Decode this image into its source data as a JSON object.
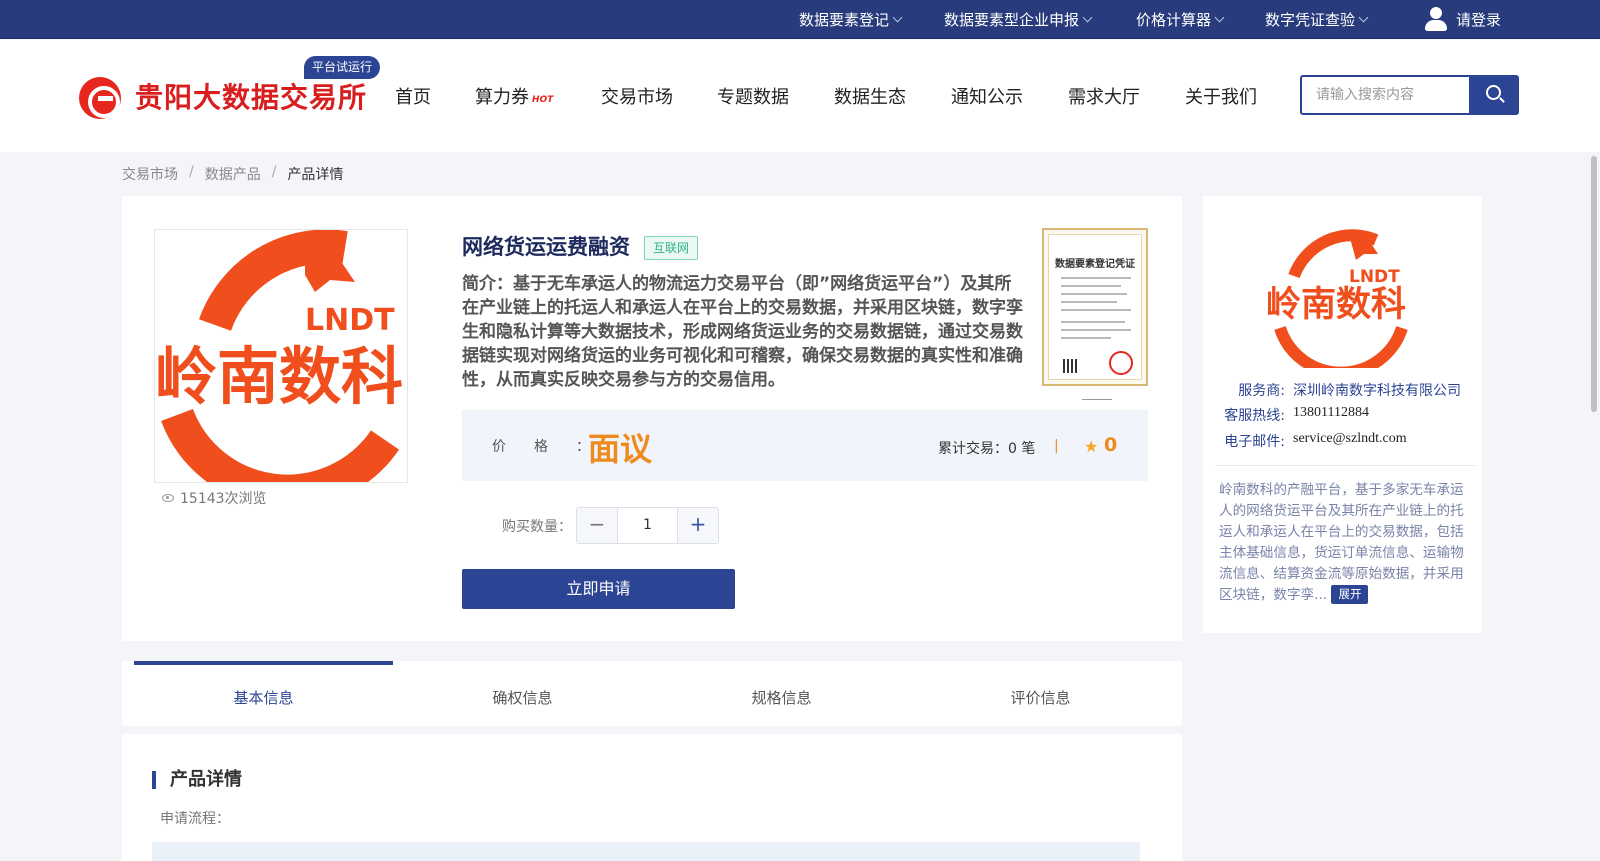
{
  "topbar": {
    "items": [
      {
        "label": "数据要素登记"
      },
      {
        "label": "数据要素型企业申报"
      },
      {
        "label": "价格计算器"
      },
      {
        "label": "数字凭证查验"
      }
    ],
    "login_label": "请登录"
  },
  "header": {
    "site_name": "贵阳大数据交易所",
    "trial_badge": "平台试运行",
    "nav": [
      {
        "label": "首页"
      },
      {
        "label": "算力券",
        "badge": "HOT"
      },
      {
        "label": "交易市场"
      },
      {
        "label": "专题数据"
      },
      {
        "label": "数据生态"
      },
      {
        "label": "通知公示"
      },
      {
        "label": "需求大厅"
      },
      {
        "label": "关于我们"
      }
    ],
    "search_placeholder": "请输入搜索内容"
  },
  "breadcrumb": {
    "items": [
      "交易市场",
      "数据产品",
      "产品详情"
    ],
    "separator": "/"
  },
  "product": {
    "image_logo_text": "LNDT",
    "image_logo_name": "岭南数科",
    "views": "15143次浏览",
    "title": "网络货运运费融资",
    "tag": "互联网",
    "intro": "简介：基于无车承运人的物流运力交易平台（即”网络货运平台”）及其所在产业链上的托运人和承运人在平台上的交易数据，并采用区块链，数字孪生和隐私计算等大数据技术，形成网络货运业务的交易数据链，通过交易数据链实现对网络货运的业务可视化和可稽察，确保交易数据的真实性和准确性，从而真实反映交易参与方的交易信用。",
    "certificate_title": "数据要素登记凭证",
    "price_label": "价格：",
    "price_value": "面议",
    "trade_count": "累计交易：0 笔",
    "trade_separator": "|",
    "rating": "0",
    "quantity_label": "购买数量：",
    "quantity_value": "1",
    "minus_symbol": "−",
    "plus_symbol": "+",
    "apply_label": "立即申请"
  },
  "provider": {
    "logo_text": "LNDT",
    "logo_name": "岭南数科",
    "rows": [
      {
        "key": "服务商:",
        "value": "深圳岭南数字科技有限公司"
      },
      {
        "key": "客服热线:",
        "value": "13801112884"
      },
      {
        "key": "电子邮件:",
        "value": "service@szlndt.com"
      }
    ],
    "description": "岭南数科的产融平台，基于多家无车承运人的网络货运平台及其所在产业链上的托运人和承运人在平台上的交易数据，包括主体基础信息，货运订单流信息、运输物流信息、结算资金流等原始数据，并采用区块链，数字孪...",
    "expand_label": "展开"
  },
  "tabs": [
    {
      "label": "基本信息",
      "active": true
    },
    {
      "label": "确权信息"
    },
    {
      "label": "规格信息"
    },
    {
      "label": "评价信息"
    }
  ],
  "detail": {
    "title": "产品详情",
    "apply_process_label": "申请流程："
  },
  "colors": {
    "brand_navy": "#2b4494",
    "brand_red": "#e5271e",
    "logo_orange": "#f04e1c",
    "price_orange": "#ee8b1e",
    "tag_green": "#2fb38a"
  },
  "icons": [
    "chevron-down-icon",
    "user-icon",
    "search-icon",
    "eye-icon",
    "star-icon",
    "minus-icon",
    "plus-icon"
  ]
}
